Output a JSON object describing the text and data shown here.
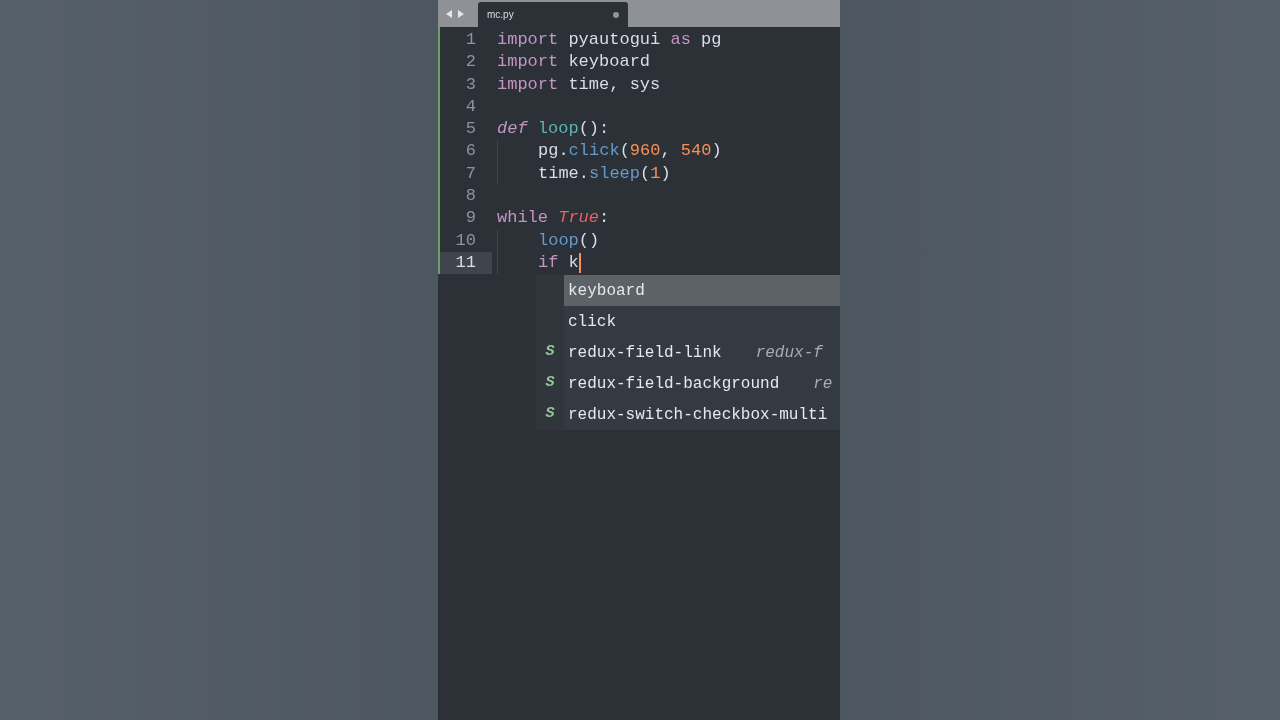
{
  "tab": {
    "title": "mc.py",
    "modified": true
  },
  "lines": [
    {
      "number": "1",
      "current": false,
      "indented": false,
      "tokens": [
        {
          "text": "import",
          "kind": "keyword"
        },
        {
          "text": " pyautogui ",
          "kind": "plain"
        },
        {
          "text": "as",
          "kind": "keyword"
        },
        {
          "text": " pg",
          "kind": "plain"
        }
      ]
    },
    {
      "number": "2",
      "current": false,
      "indented": false,
      "tokens": [
        {
          "text": "import",
          "kind": "keyword"
        },
        {
          "text": " keyboard",
          "kind": "plain"
        }
      ]
    },
    {
      "number": "3",
      "current": false,
      "indented": false,
      "tokens": [
        {
          "text": "import",
          "kind": "keyword"
        },
        {
          "text": " time, sys",
          "kind": "plain"
        }
      ]
    },
    {
      "number": "4",
      "current": false,
      "indented": false
    },
    {
      "number": "5",
      "current": false,
      "indented": false,
      "tokens": [
        {
          "text": "def",
          "kind": "storage"
        },
        {
          "text": " loop",
          "kind": "defname"
        },
        {
          "text": "():",
          "kind": "plain"
        }
      ]
    },
    {
      "number": "6",
      "current": false,
      "indented": true,
      "tokens": [
        {
          "text": "pg.",
          "kind": "plain"
        },
        {
          "text": "click",
          "kind": "call"
        },
        {
          "text": "(",
          "kind": "plain"
        },
        {
          "text": "960",
          "kind": "number"
        },
        {
          "text": ", ",
          "kind": "plain"
        },
        {
          "text": "540",
          "kind": "number"
        },
        {
          "text": ")",
          "kind": "plain"
        }
      ]
    },
    {
      "number": "7",
      "current": false,
      "indented": true,
      "tokens": [
        {
          "text": "time.",
          "kind": "plain"
        },
        {
          "text": "sleep",
          "kind": "call"
        },
        {
          "text": "(",
          "kind": "plain"
        },
        {
          "text": "1",
          "kind": "number"
        },
        {
          "text": ")",
          "kind": "plain"
        }
      ]
    },
    {
      "number": "8",
      "current": false,
      "indented": false
    },
    {
      "number": "9",
      "current": false,
      "indented": false,
      "tokens": [
        {
          "text": "while",
          "kind": "keyword"
        },
        {
          "text": " True",
          "kind": "constant"
        },
        {
          "text": ":",
          "kind": "plain"
        }
      ]
    },
    {
      "number": "10",
      "current": false,
      "indented": true,
      "tokens": [
        {
          "text": "loop",
          "kind": "call"
        },
        {
          "text": "()",
          "kind": "plain"
        }
      ]
    },
    {
      "number": "11",
      "current": true,
      "indented": true,
      "tokens": [
        {
          "text": "if",
          "kind": "keyword"
        },
        {
          "text": " k",
          "kind": "plain"
        }
      ]
    }
  ],
  "completions": [
    {
      "label": "keyboard",
      "kind": "word",
      "selected": true
    },
    {
      "label": "click",
      "kind": "word",
      "selected": false
    },
    {
      "label": "redux-field-link",
      "hint": "redux-f",
      "kind": "snippet",
      "icon": "S",
      "selected": false
    },
    {
      "label": "redux-field-background",
      "hint": "re",
      "kind": "snippet",
      "icon": "S",
      "selected": false
    },
    {
      "label": "redux-switch-checkbox-multi",
      "kind": "snippet",
      "icon": "S",
      "selected": false
    }
  ]
}
